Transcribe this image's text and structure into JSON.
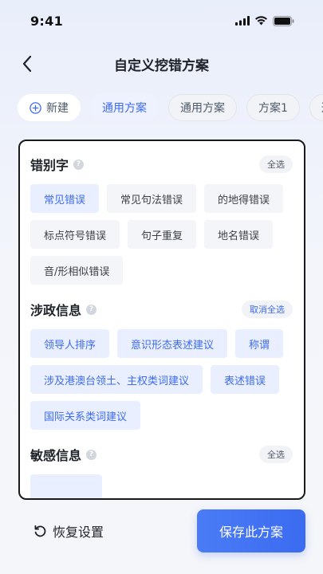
{
  "status": {
    "time": "9:41"
  },
  "header": {
    "title": "自定义挖错方案"
  },
  "tabs": [
    {
      "label": "新建"
    },
    {
      "label": "通用方案"
    },
    {
      "label": "通用方案"
    },
    {
      "label": "方案1"
    },
    {
      "label": "通"
    }
  ],
  "sections": [
    {
      "title": "错别字",
      "action": "全选",
      "chips": [
        {
          "label": "常见错误",
          "selected": true
        },
        {
          "label": "常见句法错误",
          "selected": false
        },
        {
          "label": "的地得错误",
          "selected": false
        },
        {
          "label": "标点符号错误",
          "selected": false
        },
        {
          "label": "句子重复",
          "selected": false
        },
        {
          "label": "地名错误",
          "selected": false
        },
        {
          "label": "音/形相似错误",
          "selected": false
        }
      ]
    },
    {
      "title": "涉政信息",
      "action": "取消全选",
      "chips": [
        {
          "label": "领导人排序",
          "selected": true
        },
        {
          "label": "意识形态表述建议",
          "selected": true
        },
        {
          "label": "称谓",
          "selected": true
        },
        {
          "label": "涉及港澳台领土、主权类词建议",
          "selected": true
        },
        {
          "label": "表述错误",
          "selected": true
        },
        {
          "label": "国际关系类词建议",
          "selected": true
        }
      ]
    },
    {
      "title": "敏感信息",
      "action": "全选",
      "chips": [
        {
          "label": "",
          "selected": true
        }
      ]
    }
  ],
  "footer": {
    "reset_label": "恢复设置",
    "save_label": "保存此方案"
  },
  "colors": {
    "accent": "#3d6bf1",
    "chip_selected_bg": "#e9efff",
    "chip_bg": "#f4f5f8"
  }
}
